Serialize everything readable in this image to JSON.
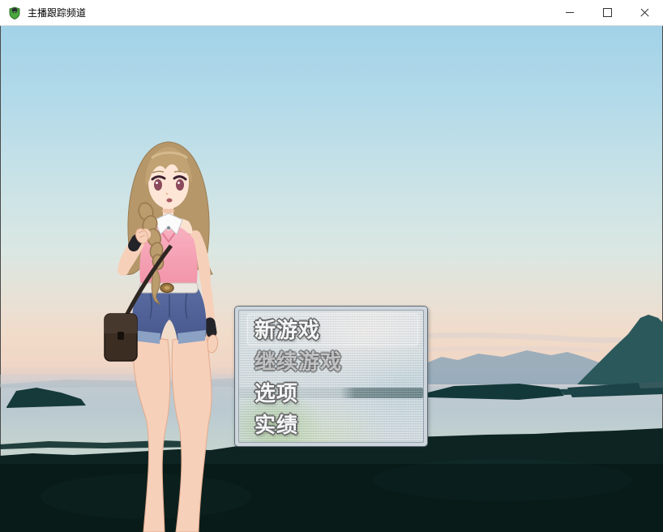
{
  "titlebar": {
    "title": "主播跟踪频道",
    "icons": {
      "app": "mascot-shield-icon",
      "minimize": "minimize-line-icon",
      "maximize": "maximize-square-icon",
      "close": "close-x-icon"
    }
  },
  "menu": {
    "items": [
      {
        "label": "新游戏",
        "enabled": true,
        "selected": true
      },
      {
        "label": "继续游戏",
        "enabled": false,
        "selected": false
      },
      {
        "label": "选项",
        "enabled": true,
        "selected": false
      },
      {
        "label": "实绩",
        "enabled": true,
        "selected": false
      }
    ]
  },
  "scene": {
    "colors": {
      "sky_top": "#a2d2e8",
      "sky_sunset_peach": "#f2d8c6",
      "water": "#bac9d0",
      "shore_dark": "#0d2422",
      "mountain_teal": "#2b585b",
      "girl_top_pink": "#f4a0b4",
      "girl_shorts_denim": "#51649b",
      "girl_hair_brown": "#b5976a",
      "menu_frame": "#ced5dc",
      "menu_text_outline": "#585858"
    }
  }
}
